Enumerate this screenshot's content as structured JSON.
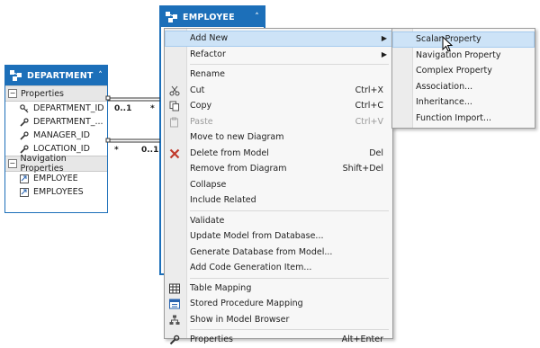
{
  "department": {
    "title": "DEPARTMENT",
    "properties_header": "Properties",
    "properties": [
      "DEPARTMENT_ID",
      "DEPARTMENT_...",
      "MANAGER_ID",
      "LOCATION_ID"
    ],
    "navigation_header": "Navigation Properties",
    "navigation": [
      "EMPLOYEE",
      "EMPLOYEES"
    ]
  },
  "employee": {
    "title": "EMPLOYEE"
  },
  "associations": {
    "top_left": "0..1",
    "top_right": "*",
    "bottom_left": "*",
    "bottom_right": "0..1"
  },
  "context_menu": {
    "items": [
      {
        "label": "Add New",
        "shortcut": "",
        "submenu": true,
        "highlighted": true
      },
      {
        "label": "Refactor",
        "shortcut": "",
        "submenu": true
      },
      {
        "separator": true
      },
      {
        "label": "Rename",
        "shortcut": ""
      },
      {
        "label": "Cut",
        "shortcut": "Ctrl+X",
        "icon": "scissors-icon"
      },
      {
        "label": "Copy",
        "shortcut": "Ctrl+C",
        "icon": "copy-icon"
      },
      {
        "label": "Paste",
        "shortcut": "Ctrl+V",
        "icon": "paste-icon",
        "disabled": true
      },
      {
        "label": "Move to new Diagram",
        "shortcut": ""
      },
      {
        "label": "Delete from Model",
        "shortcut": "Del",
        "icon": "delete-icon"
      },
      {
        "label": "Remove from Diagram",
        "shortcut": "Shift+Del"
      },
      {
        "label": "Collapse",
        "shortcut": ""
      },
      {
        "label": "Include Related",
        "shortcut": ""
      },
      {
        "separator": true
      },
      {
        "label": "Validate",
        "shortcut": ""
      },
      {
        "label": "Update Model from Database...",
        "shortcut": ""
      },
      {
        "label": "Generate Database from Model...",
        "shortcut": ""
      },
      {
        "label": "Add Code Generation Item...",
        "shortcut": ""
      },
      {
        "separator": true
      },
      {
        "label": "Table Mapping",
        "shortcut": "",
        "icon": "table-mapping-icon"
      },
      {
        "label": "Stored Procedure Mapping",
        "shortcut": "",
        "icon": "stored-procedure-icon"
      },
      {
        "label": "Show in Model Browser",
        "shortcut": "",
        "icon": "model-browser-icon"
      },
      {
        "separator": true
      },
      {
        "label": "Properties",
        "shortcut": "Alt+Enter",
        "icon": "wrench-icon"
      }
    ]
  },
  "submenu": {
    "items": [
      {
        "label": "Scalar Property",
        "highlighted": true
      },
      {
        "label": "Navigation Property"
      },
      {
        "label": "Complex Property"
      },
      {
        "label": "Association..."
      },
      {
        "label": "Inheritance..."
      },
      {
        "label": "Function Import..."
      }
    ]
  },
  "colors": {
    "entity_blue": "#1c6fb9",
    "highlight": "#cde3f7",
    "delete_red": "#c0392b"
  }
}
